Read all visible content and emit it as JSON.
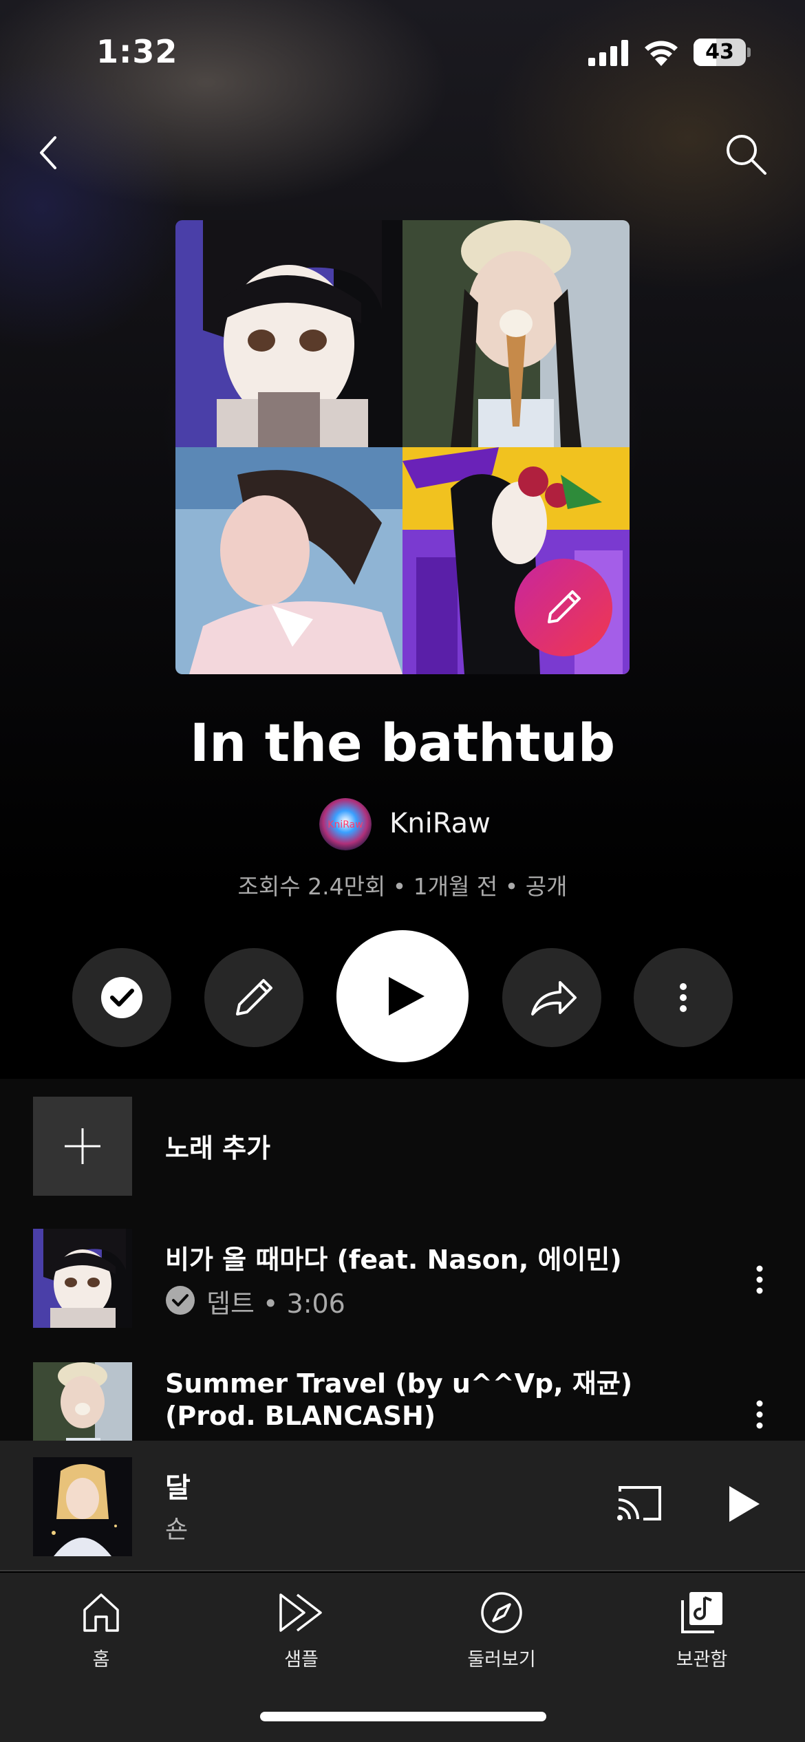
{
  "status_bar": {
    "time": "1:32",
    "battery_level": "43",
    "battery_fraction": 0.43
  },
  "header": {
    "back_icon": "chevron-left-icon",
    "search_icon": "search-icon"
  },
  "playlist": {
    "title": "In the bathtub",
    "owner": {
      "name": "KniRaw",
      "avatar_text": "KniRaw"
    },
    "meta": "조회수 2.4만회 • 1개월 전 • 공개"
  },
  "actions": {
    "saved_icon": "check-circle-icon",
    "edit_icon": "pencil-icon",
    "play_icon": "play-icon",
    "share_icon": "share-arrow-icon",
    "more_icon": "more-vertical-icon"
  },
  "list": {
    "add_song_label": "노래 추가",
    "tracks": [
      {
        "title": "비가 올 때마다 (feat. Nason, 에이민)",
        "artist": "뎁트",
        "duration": "3:06"
      },
      {
        "title_line1": "Summer Travel (by u^^Vp, 재균)",
        "title_line2": "(Prod. BLANCASH)"
      }
    ]
  },
  "mini_player": {
    "title": "달",
    "artist": "숀"
  },
  "bottom_nav": [
    {
      "label": "홈",
      "icon": "home-icon"
    },
    {
      "label": "샘플",
      "icon": "samples-icon"
    },
    {
      "label": "둘러보기",
      "icon": "compass-icon"
    },
    {
      "label": "보관함",
      "icon": "library-icon",
      "active": true
    }
  ],
  "colors": {
    "accent_gradient_start": "#c7269e",
    "accent_gradient_end": "#f0384f",
    "background": "#000000",
    "surface": "#212121"
  }
}
